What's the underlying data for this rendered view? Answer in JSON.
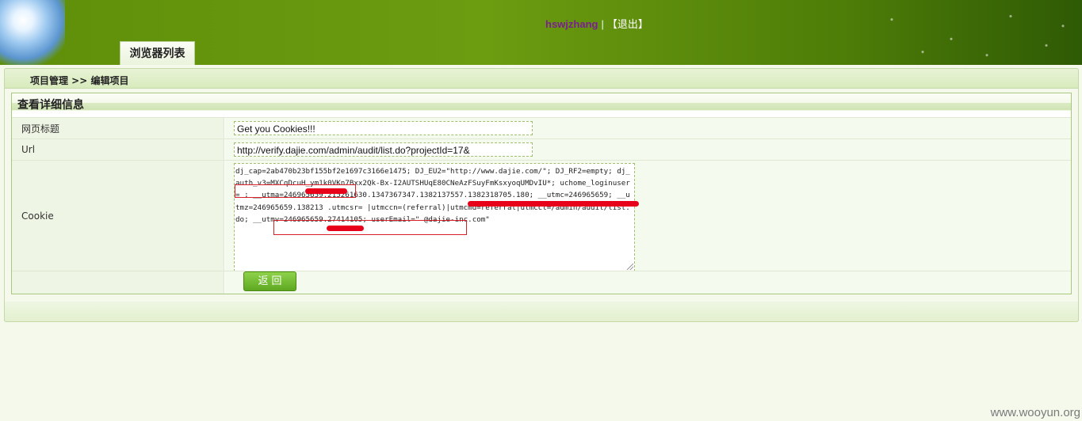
{
  "header": {
    "username": "hswjzhang",
    "separator": "|",
    "logout_label": "【退出】",
    "tab_label": "浏览器列表"
  },
  "breadcrumb": "项目管理 >> 编辑项目",
  "panel": {
    "title": "查看详细信息",
    "rows": {
      "title_label": "网页标题",
      "title_value": "Get you Cookies!!!",
      "url_label": "Url",
      "url_value": "http://verify.dajie.com/admin/audit/list.do?projectId=17&",
      "cookie_label": "Cookie",
      "cookie_value": "dj_cap=2ab470b23bf155bf2e1697c3166e1475; DJ_EU2=\"http://www.dajie.com/\"; DJ_RF2=empty; dj_auth_v3=MXCqDcuH_ym1k0VKn7Bxx2Qk-Bx-I2AUTSHUqE80CNeAzFSuyFmKsxyoqUMDvIU*; uchome_loginuser=        ; __utma=246965659.215261630.1347367347.1382137557.1382318705.180; __utmc=246965659; __utmz=246965659.138213          .utmcsr=         |utmccn=(referral)|utmcmd=referral|utmcct=/admin/audit/list.do; __utmv=246965659.27414105; userEmail=\"         @dajie-inc.com\""
    },
    "back_button": "返回"
  },
  "watermark": "www.wooyun.org",
  "colors": {
    "header_green": "#6c9c10",
    "username": "#7a1f8f",
    "redaction": "#e8001a",
    "button_green": "#6cb52b"
  }
}
